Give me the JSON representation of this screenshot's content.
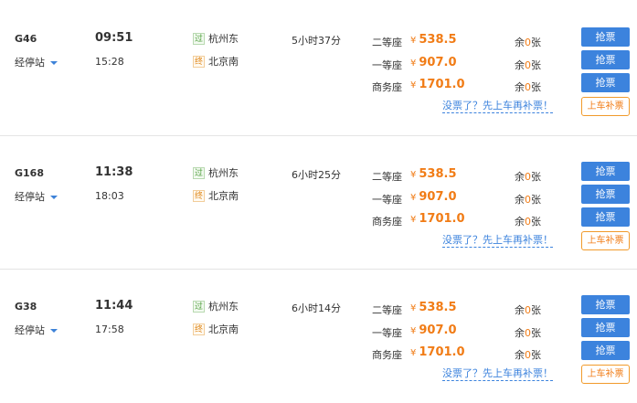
{
  "trains": [
    {
      "train_no": "G46",
      "stops_label": "经停站",
      "depart_time": "09:51",
      "arrive_time": "15:28",
      "from_badge": "过",
      "from_station": "杭州东",
      "to_badge": "终",
      "to_station": "北京南",
      "duration": "5小时37分",
      "seats": [
        {
          "name": "二等座",
          "yen": "¥",
          "price": "538.5",
          "remain_prefix": "余",
          "remain_count": "0",
          "remain_suffix": "张",
          "button": "抢票"
        },
        {
          "name": "一等座",
          "yen": "¥",
          "price": "907.0",
          "remain_prefix": "余",
          "remain_count": "0",
          "remain_suffix": "张",
          "button": "抢票"
        },
        {
          "name": "商务座",
          "yen": "¥",
          "price": "1701.0",
          "remain_prefix": "余",
          "remain_count": "0",
          "remain_suffix": "张",
          "button": "抢票"
        }
      ],
      "makeup_text": "没票了？先上车再补票！",
      "makeup_button": "上车补票"
    },
    {
      "train_no": "G168",
      "stops_label": "经停站",
      "depart_time": "11:38",
      "arrive_time": "18:03",
      "from_badge": "过",
      "from_station": "杭州东",
      "to_badge": "终",
      "to_station": "北京南",
      "duration": "6小时25分",
      "seats": [
        {
          "name": "二等座",
          "yen": "¥",
          "price": "538.5",
          "remain_prefix": "余",
          "remain_count": "0",
          "remain_suffix": "张",
          "button": "抢票"
        },
        {
          "name": "一等座",
          "yen": "¥",
          "price": "907.0",
          "remain_prefix": "余",
          "remain_count": "0",
          "remain_suffix": "张",
          "button": "抢票"
        },
        {
          "name": "商务座",
          "yen": "¥",
          "price": "1701.0",
          "remain_prefix": "余",
          "remain_count": "0",
          "remain_suffix": "张",
          "button": "抢票"
        }
      ],
      "makeup_text": "没票了？先上车再补票！",
      "makeup_button": "上车补票"
    },
    {
      "train_no": "G38",
      "stops_label": "经停站",
      "depart_time": "11:44",
      "arrive_time": "17:58",
      "from_badge": "过",
      "from_station": "杭州东",
      "to_badge": "终",
      "to_station": "北京南",
      "duration": "6小时14分",
      "seats": [
        {
          "name": "二等座",
          "yen": "¥",
          "price": "538.5",
          "remain_prefix": "余",
          "remain_count": "0",
          "remain_suffix": "张",
          "button": "抢票"
        },
        {
          "name": "一等座",
          "yen": "¥",
          "price": "907.0",
          "remain_prefix": "余",
          "remain_count": "0",
          "remain_suffix": "张",
          "button": "抢票"
        },
        {
          "name": "商务座",
          "yen": "¥",
          "price": "1701.0",
          "remain_prefix": "余",
          "remain_count": "0",
          "remain_suffix": "张",
          "button": "抢票"
        }
      ],
      "makeup_text": "没票了？先上车再补票！",
      "makeup_button": "上车补票"
    }
  ],
  "colors": {
    "accent_blue": "#3c83dd",
    "price_orange": "#f17c16",
    "divider": "#e4e4e4"
  }
}
